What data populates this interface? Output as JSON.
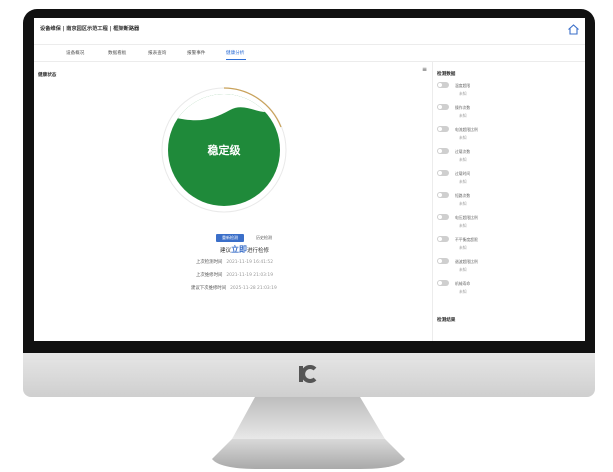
{
  "header": {
    "breadcrumb": "设备维保 | 南京园区示范工程 | 框架断路器"
  },
  "tabs": [
    {
      "label": "设备概况",
      "active": false
    },
    {
      "label": "数据看板",
      "active": false
    },
    {
      "label": "报表查询",
      "active": false
    },
    {
      "label": "报警事件",
      "active": false
    },
    {
      "label": "健康分析",
      "active": true
    }
  ],
  "main": {
    "section_title": "健康状态",
    "level_label": "稳定级",
    "btn_test": "重新检测",
    "btn_history": "历史检测",
    "advice_prefix": "建议",
    "advice_emphasis": "立即",
    "advice_suffix": "进行检修",
    "info": [
      {
        "label": "上次检测时间",
        "value": "2021-11-19 16:41:52"
      },
      {
        "label": "上次维修时间",
        "value": "2021-11-19 21:03:19"
      },
      {
        "label": "建议下次维修时间",
        "value": "2025-11-28 21:03:19"
      }
    ]
  },
  "side": {
    "title": "检测数据",
    "items": [
      {
        "name": "温度超限",
        "status": "未知"
      },
      {
        "name": "操作次数",
        "status": "未知"
      },
      {
        "name": "电流超限比例",
        "status": "未知"
      },
      {
        "name": "过载次数",
        "status": "未知"
      },
      {
        "name": "过载时间",
        "status": "未知"
      },
      {
        "name": "短路次数",
        "status": "未知"
      },
      {
        "name": "电压超限比例",
        "status": "未知"
      },
      {
        "name": "不平衡度超限",
        "status": "未知"
      },
      {
        "name": "谐波超限比例",
        "status": "未知"
      },
      {
        "name": "机械寿命",
        "status": "未知"
      }
    ],
    "title2": "检测结果"
  },
  "colors": {
    "accent": "#3b6fc9",
    "level_green": "#1f8a3a"
  }
}
